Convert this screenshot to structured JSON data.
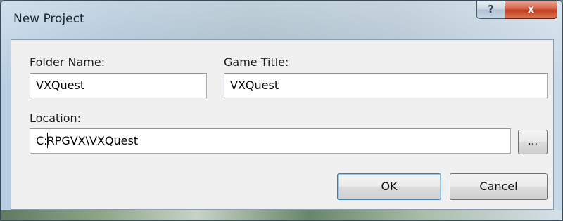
{
  "window": {
    "title": "New Project",
    "help_glyph": "?",
    "close_glyph": "x"
  },
  "form": {
    "folder_name_label": "Folder Name:",
    "folder_name_value": "VXQuest",
    "game_title_label": "Game Title:",
    "game_title_value": "VXQuest",
    "location_label": "Location:",
    "location_value_before_caret": "C:",
    "location_value_after_caret": "RPGVX\\VXQuest",
    "browse_label": "..."
  },
  "buttons": {
    "ok_label": "OK",
    "cancel_label": "Cancel"
  },
  "icons": {
    "help": "help-icon",
    "close": "close-icon"
  },
  "colors": {
    "close_button": "#c33d20",
    "default_button_border": "#3c7fb1",
    "dialog_client": "#f0f0f0"
  }
}
